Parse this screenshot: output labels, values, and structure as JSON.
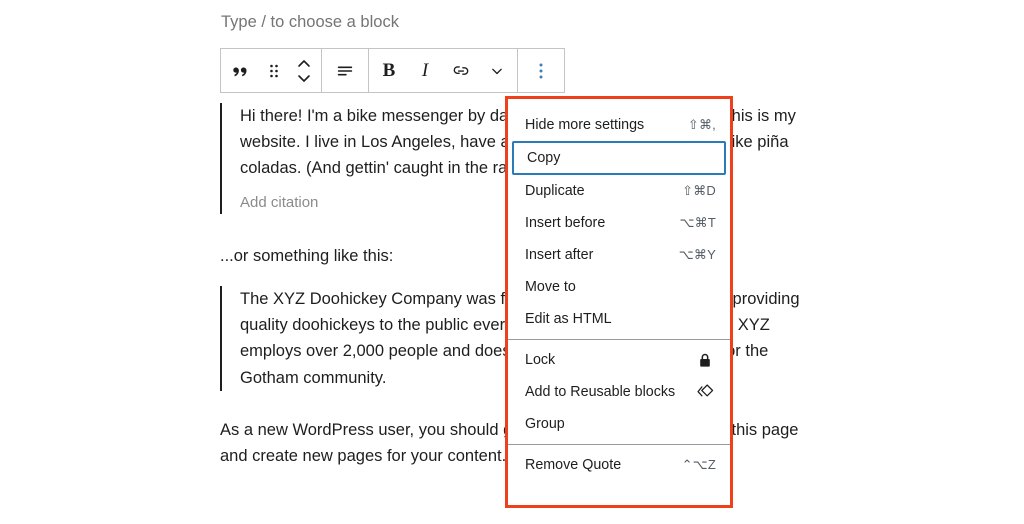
{
  "editor": {
    "placeholder_prompt": "Type / to choose a block",
    "toolbar": {
      "groups": [
        {
          "buttons": [
            {
              "name": "block-type-quote-icon",
              "label": "Quote block type"
            },
            {
              "name": "drag-handle-icon",
              "label": "Drag"
            },
            {
              "name": "move-up-down-icon",
              "label": "Move up or down"
            }
          ]
        },
        {
          "buttons": [
            {
              "name": "align-text-icon",
              "label": "Change alignment"
            }
          ]
        },
        {
          "buttons": [
            {
              "name": "bold-icon",
              "label": "B"
            },
            {
              "name": "italic-icon",
              "label": "I"
            },
            {
              "name": "link-icon",
              "label": "Link"
            },
            {
              "name": "more-rich-text-icon",
              "label": "More"
            }
          ]
        },
        {
          "buttons": [
            {
              "name": "options-ellipsis-icon",
              "label": "Options"
            }
          ]
        }
      ]
    },
    "quote_1": {
      "text": "Hi there! I'm a bike messenger by day, aspiring actor by night, and this is my website. I live in Los Angeles, have a great dog named Jack, and I like piña coladas. (And gettin' caught in the rain.)",
      "citation_placeholder": "Add citation"
    },
    "paragraph_middle": "...or something like this:",
    "quote_2": {
      "text": "The XYZ Doohickey Company was founded in 1971, and has been providing quality doohickeys to the public ever since. Located in Gotham City, XYZ employs over 2,000 people and does all kinds of awesome things for the Gotham community."
    },
    "paragraph_bottom": "As a new WordPress user, you should go to your dashboard to delete this page and create new pages for your content."
  },
  "more_menu": {
    "highlight_color": "#f03f1d",
    "focus_color": "#2b7bb9",
    "sections": [
      {
        "items": [
          {
            "label": "Hide more settings",
            "shortcut": "⇧⌘,",
            "icon": "",
            "focused": false
          },
          {
            "label": "Copy",
            "shortcut": "",
            "icon": "",
            "focused": true
          },
          {
            "label": "Duplicate",
            "shortcut": "⇧⌘D",
            "icon": "",
            "focused": false
          },
          {
            "label": "Insert before",
            "shortcut": "⌥⌘T",
            "icon": "",
            "focused": false
          },
          {
            "label": "Insert after",
            "shortcut": "⌥⌘Y",
            "icon": "",
            "focused": false
          },
          {
            "label": "Move to",
            "shortcut": "",
            "icon": "",
            "focused": false
          },
          {
            "label": "Edit as HTML",
            "shortcut": "",
            "icon": "",
            "focused": false
          }
        ]
      },
      {
        "items": [
          {
            "label": "Lock",
            "shortcut": "",
            "icon": "lock-icon",
            "focused": false
          },
          {
            "label": "Add to Reusable blocks",
            "shortcut": "",
            "icon": "reusable-block-icon",
            "focused": false
          },
          {
            "label": "Group",
            "shortcut": "",
            "icon": "",
            "focused": false
          }
        ]
      },
      {
        "items": [
          {
            "label": "Remove Quote",
            "shortcut": "⌃⌥Z",
            "icon": "",
            "focused": false
          }
        ]
      }
    ]
  }
}
